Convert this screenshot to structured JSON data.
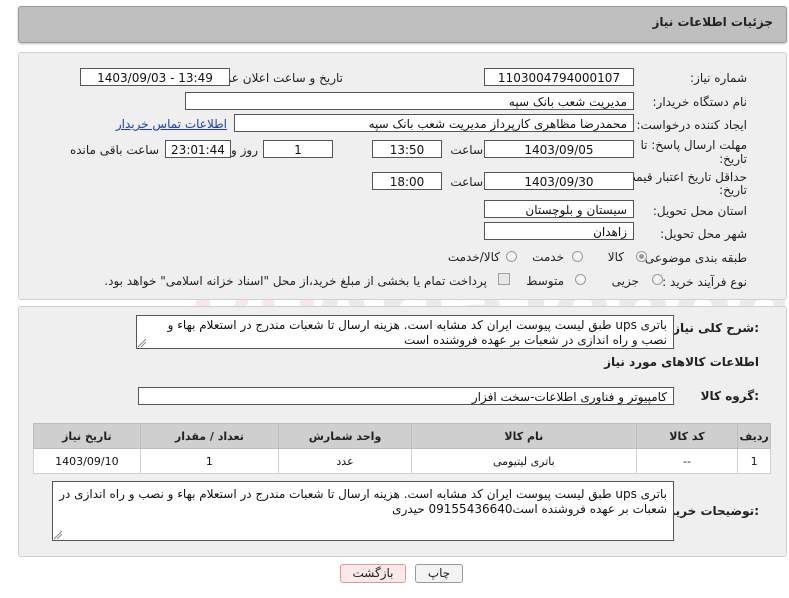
{
  "header": {
    "title": "جزئیات اطلاعات نیاز"
  },
  "fields": {
    "need_number": {
      "label": "شماره نیاز:",
      "value": "1103004794000107"
    },
    "announce_datetime": {
      "label": "تاریخ و ساعت اعلان عمومی:",
      "value": "1403/09/03 - 13:49"
    },
    "buyer_org": {
      "label": "نام دستگاه خریدار:",
      "value": "مدیریت شعب بانک سپه"
    },
    "requester": {
      "label": "ایجاد کننده درخواست:",
      "value": "محمدرضا مظاهری کارپرداز مدیریت شعب بانک سپه",
      "contact_link": "اطلاعات تماس خریدار"
    },
    "deadline": {
      "label_line1": "مهلت ارسال پاسخ: تا",
      "label_line2": "تاریخ:",
      "date": "1403/09/05",
      "time_label": "ساعت",
      "time": "13:50",
      "days": "1",
      "days_label": "روز و",
      "remaining": "23:01:44",
      "remaining_label": "ساعت باقی مانده"
    },
    "price_validity": {
      "label_line1": "حداقل تاریخ اعتبار قیمت: تا",
      "label_line2": "تاریخ:",
      "date": "1403/09/30",
      "time_label": "ساعت",
      "time": "18:00"
    },
    "province": {
      "label": "استان محل تحویل:",
      "value": "سیستان و بلوچستان"
    },
    "city": {
      "label": "شهر محل تحویل:",
      "value": "زاهدان"
    },
    "category": {
      "label": "طبقه بندی موضوعی:",
      "options": [
        "کالا",
        "خدمت",
        "کالا/خدمت"
      ],
      "selected": "کالا"
    },
    "purchase_process": {
      "label": "نوع فرآیند خرید :",
      "options": [
        "جزیی",
        "متوسط"
      ],
      "checkbox_label": "پرداخت تمام یا بخشی از مبلغ خرید،از محل \"اسناد خزانه اسلامی\" خواهد بود."
    }
  },
  "description": {
    "label": "شرح کلی نیاز:",
    "text": "باتری ups طبق لیست پیوست ایران کد مشابه است. هزینه ارسال تا شعبات مندرج در استعلام بهاء و نصب و راه اندازی در شعبات بر عهده فروشنده است"
  },
  "goods_section": {
    "title": "اطلاعات کالاهای مورد نیاز",
    "group_label": "گروه کالا:",
    "group_value": "کامپیوتر و فناوری اطلاعات-سخت افزار"
  },
  "table": {
    "headers": [
      "ردیف",
      "کد کالا",
      "نام کالا",
      "واحد شمارش",
      "تعداد / مقدار",
      "تاریخ نیاز"
    ],
    "rows": [
      [
        "1",
        "--",
        "باتری لیتیومی",
        "عدد",
        "1",
        "1403/09/10"
      ]
    ]
  },
  "buyer_notes": {
    "label": "توضیحات خریدار:",
    "text": "باتری ups طبق لیست پیوست ایران کد مشابه است. هزینه ارسال تا شعبات مندرج در استعلام بهاء و نصب و راه اندازی در شعبات بر عهده فروشنده است09155436640 حیدری"
  },
  "buttons": {
    "print": "چاپ",
    "back": "بازگشت"
  },
  "watermark": {
    "text": "AriaTender.neT"
  },
  "colors": {
    "link": "#1a3fb5",
    "header_bg": "#bfbfbf",
    "panel_bg": "#efefef",
    "table_header": "#cfcfcf"
  }
}
